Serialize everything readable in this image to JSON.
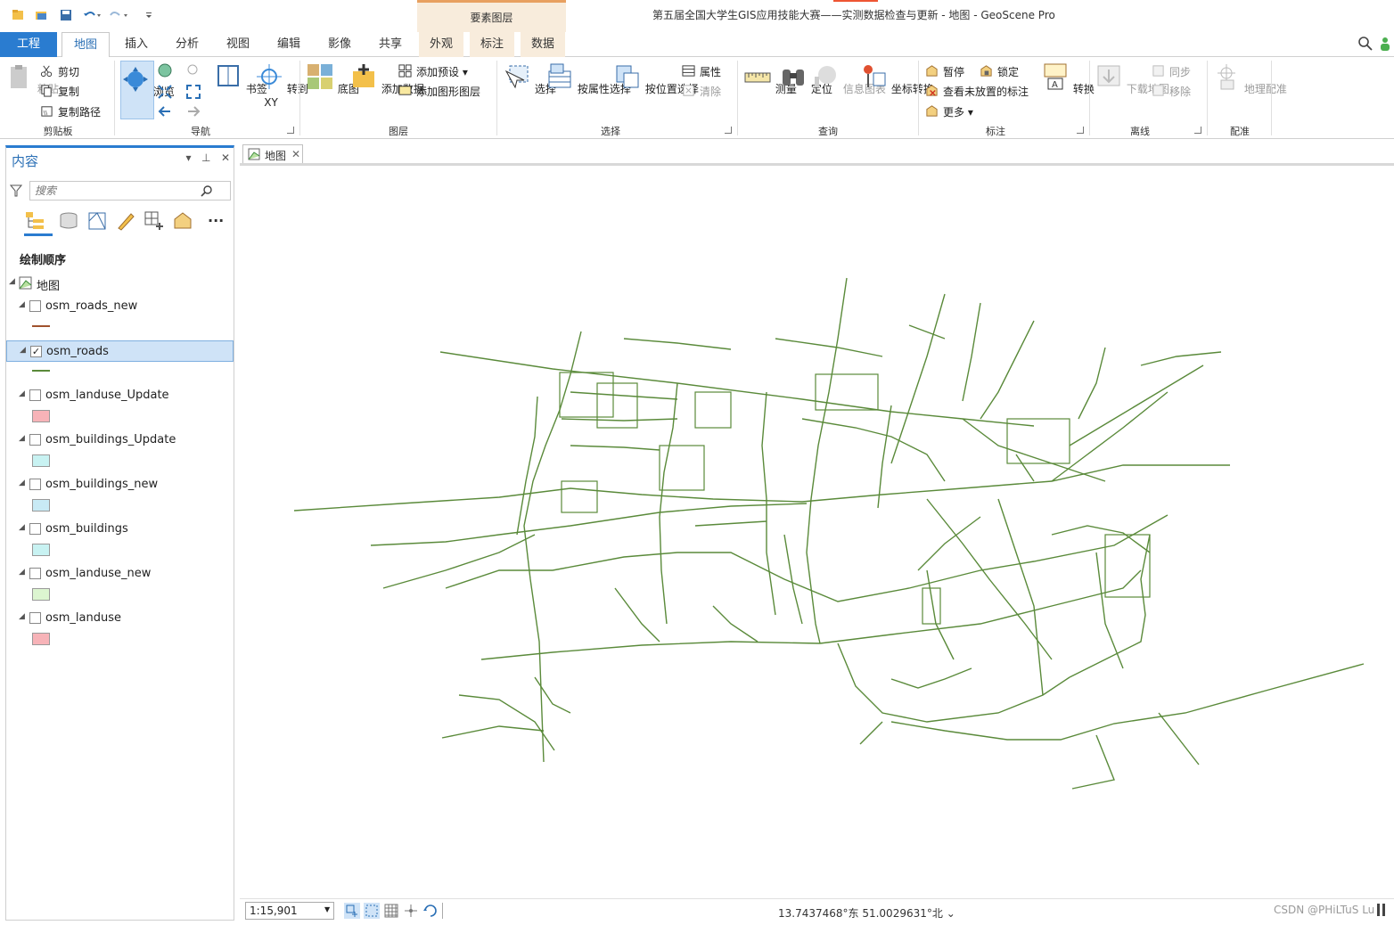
{
  "window": {
    "title": "第五届全国大学生GIS应用技能大赛——实测数据检查与更新 - 地图 - GeoScene Pro",
    "context_group": "要素图层"
  },
  "tabs": [
    "工程",
    "地图",
    "插入",
    "分析",
    "视图",
    "编辑",
    "影像",
    "共享",
    "外观",
    "标注",
    "数据"
  ],
  "ribbon": {
    "clipboard": {
      "paste": "粘贴",
      "cut": "剪切",
      "copy": "复制",
      "copy_path": "复制路径",
      "group": "剪贴板"
    },
    "navigate": {
      "explore": "浏览",
      "bookmarks": "书签",
      "goto": "转到",
      "goto_sub": "XY",
      "group": "导航"
    },
    "layer": {
      "basemap": "底图",
      "add_data": "添加数据",
      "add_preset": "添加预设",
      "add_graphics": "添加图形图层",
      "group": "图层"
    },
    "selection": {
      "select": "选择",
      "by_attr": "按属性选择",
      "by_loc": "按位置选择",
      "attributes": "属性",
      "clear": "清除",
      "group": "选择"
    },
    "inquiry": {
      "measure": "测量",
      "locate": "定位",
      "infographics": "信息图表",
      "coord_convert": "坐标转换",
      "group": "查询"
    },
    "labeling": {
      "pause": "暂停",
      "lock": "锁定",
      "unplaced": "查看未放置的标注",
      "more": "更多",
      "convert": "转换",
      "group": "标注"
    },
    "offline": {
      "download": "下载地图",
      "sync": "同步",
      "remove": "移除",
      "group": "离线"
    },
    "georef": {
      "georeference": "地理配准",
      "group": "配准"
    }
  },
  "contents_pane": {
    "title": "内容",
    "search_placeholder": "搜索",
    "heading": "绘制顺序",
    "map_name": "地图",
    "layers": [
      {
        "name": "osm_roads_new",
        "checked": false,
        "symbol": "line",
        "color": "#a0522d"
      },
      {
        "name": "osm_roads",
        "checked": true,
        "symbol": "line",
        "color": "#5a8a3a",
        "selected": true
      },
      {
        "name": "osm_landuse_Update",
        "checked": false,
        "symbol": "fill",
        "color": "#f7b3b8"
      },
      {
        "name": "osm_buildings_Update",
        "checked": false,
        "symbol": "fill",
        "color": "#c8f2f2"
      },
      {
        "name": "osm_buildings_new",
        "checked": false,
        "symbol": "fill",
        "color": "#c8eaf5"
      },
      {
        "name": "osm_buildings",
        "checked": false,
        "symbol": "fill",
        "color": "#c8f2f2"
      },
      {
        "name": "osm_landuse_new",
        "checked": false,
        "symbol": "fill",
        "color": "#dcf5d0"
      },
      {
        "name": "osm_landuse",
        "checked": false,
        "symbol": "fill",
        "color": "#f7b3b8"
      }
    ]
  },
  "map_view": {
    "tab_label": "地图",
    "road_color": "#5a8a3a"
  },
  "status_bar": {
    "scale": "1:15,901",
    "coordinates": "13.7437468°东 51.0029631°北",
    "watermark": "CSDN @PHiLTuS Lu"
  }
}
